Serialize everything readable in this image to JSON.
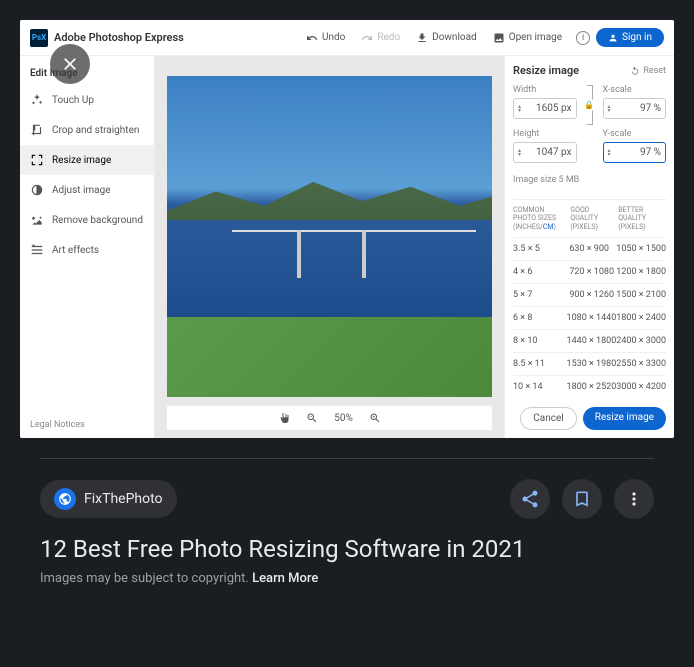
{
  "app": {
    "logo_text": "PsX",
    "title": "Adobe Photoshop Express",
    "toolbar": {
      "undo": "Undo",
      "redo": "Redo",
      "download": "Download",
      "open_image": "Open image",
      "sign_in": "Sign in"
    }
  },
  "sidebar": {
    "title": "Edit Image",
    "items": [
      {
        "label": "Touch Up"
      },
      {
        "label": "Crop and straighten"
      },
      {
        "label": "Resize image"
      },
      {
        "label": "Adjust image"
      },
      {
        "label": "Remove background"
      },
      {
        "label": "Art effects"
      }
    ],
    "legal": "Legal Notices"
  },
  "zoom": {
    "level": "50%"
  },
  "panel": {
    "title": "Resize image",
    "reset": "Reset",
    "width_label": "Width",
    "height_label": "Height",
    "xscale_label": "X-scale",
    "yscale_label": "Y-scale",
    "width_value": "1605 px",
    "height_value": "1047 px",
    "xscale_value": "97 %",
    "yscale_value": "97 %",
    "image_size_label": "Image size",
    "image_size_value": "5 MB",
    "table_head": {
      "col1a": "COMMON",
      "col1b": "PHOTO SIZES",
      "col1c_a": "(INCHES/",
      "col1c_b": "CM",
      "col1c_c": ")",
      "col2a": "GOOD",
      "col2b": "QUALITY",
      "col2c": "(PIXELS)",
      "col3a": "BETTER",
      "col3b": "QUALITY",
      "col3c": "(PIXELS)"
    },
    "rows": [
      {
        "size": "3.5 × 5",
        "good": "630 × 900",
        "better": "1050 × 1500"
      },
      {
        "size": "4 × 6",
        "good": "720 × 1080",
        "better": "1200 × 1800"
      },
      {
        "size": "5 × 7",
        "good": "900 × 1260",
        "better": "1500 × 2100"
      },
      {
        "size": "6 × 8",
        "good": "1080 × 1440",
        "better": "1800 × 2400"
      },
      {
        "size": "8 × 10",
        "good": "1440 × 1800",
        "better": "2400 × 3000"
      },
      {
        "size": "8.5 × 11",
        "good": "1530 × 1980",
        "better": "2550 × 3300"
      },
      {
        "size": "10 × 14",
        "good": "1800 × 2520",
        "better": "3000 × 4200"
      }
    ],
    "cancel": "Cancel",
    "resize": "Resize image"
  },
  "result": {
    "source": "FixThePhoto",
    "title": "12 Best Free Photo Resizing Software in 2021",
    "copyright": "Images may be subject to copyright.",
    "learn_more": "Learn More"
  }
}
